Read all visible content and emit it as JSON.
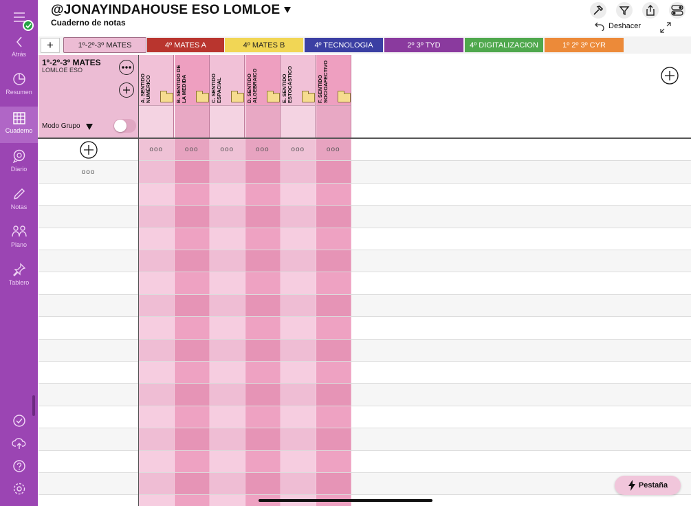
{
  "header": {
    "title": "@JONAYINDAHOUSE ESO LOMLOE",
    "subtitle": "Cuaderno de notas",
    "undo_label": "Deshacer",
    "icons": [
      "hammer-icon",
      "filter-icon",
      "share-icon",
      "toggles-icon"
    ]
  },
  "sidebar": {
    "items": [
      {
        "label": "Atrás",
        "icon": "chevron-left-icon"
      },
      {
        "label": "Resumen",
        "icon": "pie-chart-icon"
      },
      {
        "label": "Cuaderno",
        "icon": "grid-icon",
        "active": true
      },
      {
        "label": "Diario",
        "icon": "chat-icon"
      },
      {
        "label": "Notas",
        "icon": "pencil-icon"
      },
      {
        "label": "Plano",
        "icon": "people-icon"
      },
      {
        "label": "Tablero",
        "icon": "pin-icon"
      }
    ],
    "bottom_icons": [
      "check-circle-icon",
      "cloud-upload-icon",
      "help-icon",
      "settings-icon"
    ]
  },
  "tabs": [
    {
      "label": "1º-2º-3º MATES",
      "color": "#ecbcd4",
      "active": true
    },
    {
      "label": "4º MATES A",
      "color": "#b9352e"
    },
    {
      "label": "4º MATES B",
      "color": "#f1d655"
    },
    {
      "label": "4º TECNOLOGIA",
      "color": "#3b3fa3"
    },
    {
      "label": "2º 3º TYD",
      "color": "#8a3a9e"
    },
    {
      "label": "4º DIGITALIZACION",
      "color": "#4fa84d"
    },
    {
      "label": "1º 2º 3º CYR",
      "color": "#ec8a39"
    }
  ],
  "group": {
    "name": "1º-2º-3º MATES",
    "subtitle": "LOMLOE ESO",
    "mode_label": "Modo Grupo",
    "mode_enabled": false
  },
  "criteria": [
    {
      "label": "A. SENTIDO NUMÉRICO"
    },
    {
      "label": "B. SENTIDO DE LA MEDIDA"
    },
    {
      "label": "C. SENTIDO ESPACIAL"
    },
    {
      "label": "D. SENTIDO ALGEBRAICO"
    },
    {
      "label": "E. SENTIDO ESTOCÁSTICO"
    },
    {
      "label": "F. SENTIDO SOCIOAFECTIVO"
    }
  ],
  "table": {
    "dots": "ooo"
  },
  "pestana_label": "Pestaña",
  "colors": {
    "sidebar": "#9b45b3",
    "group_pink": "#ecbcd4",
    "col_light": "#f6cde0",
    "col_dark": "#ee9fc0"
  }
}
